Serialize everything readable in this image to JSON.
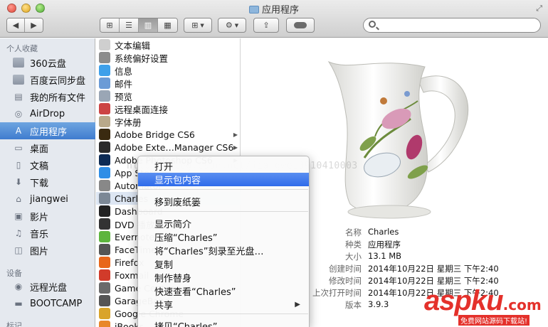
{
  "window": {
    "title": "应用程序"
  },
  "sidebar": {
    "favorites_header": "个人收藏",
    "devices_header": "设备",
    "tags_header": "标记",
    "favorites": [
      {
        "label": "360云盘",
        "icon": "folder-icon"
      },
      {
        "label": "百度云同步盘",
        "icon": "folder-icon"
      },
      {
        "label": "我的所有文件",
        "icon": "all-files-icon"
      },
      {
        "label": "AirDrop",
        "icon": "airdrop-icon"
      },
      {
        "label": "应用程序",
        "icon": "applications-icon",
        "selected": true
      },
      {
        "label": "桌面",
        "icon": "desktop-icon"
      },
      {
        "label": "文稿",
        "icon": "documents-icon"
      },
      {
        "label": "下载",
        "icon": "downloads-icon"
      },
      {
        "label": "jiangwei",
        "icon": "home-icon"
      },
      {
        "label": "影片",
        "icon": "movies-icon"
      },
      {
        "label": "音乐",
        "icon": "music-icon"
      },
      {
        "label": "图片",
        "icon": "pictures-icon"
      }
    ],
    "devices": [
      {
        "label": "远程光盘",
        "icon": "remote-disc-icon"
      },
      {
        "label": "BOOTCAMP",
        "icon": "drive-icon"
      }
    ]
  },
  "files": [
    {
      "label": "文本编辑",
      "color": "#cfcfcf",
      "arrow": false
    },
    {
      "label": "系统偏好设置",
      "color": "#8c8c8c",
      "arrow": false
    },
    {
      "label": "信息",
      "color": "#3ea0ea",
      "arrow": false
    },
    {
      "label": "邮件",
      "color": "#6b9bd6",
      "arrow": false
    },
    {
      "label": "预览",
      "color": "#9aa6b5",
      "arrow": false
    },
    {
      "label": "远程桌面连接",
      "color": "#c44",
      "arrow": false
    },
    {
      "label": "字体册",
      "color": "#b9a98a",
      "arrow": false
    },
    {
      "label": "Adobe Bridge CS6",
      "color": "#3a2a10",
      "arrow": true
    },
    {
      "label": "Adobe Exte…Manager CS6",
      "color": "#2b2b2b",
      "arrow": true
    },
    {
      "label": "Adobe Photoshop CS6",
      "color": "#0d2b55",
      "arrow": true
    },
    {
      "label": "App Store",
      "color": "#2f8ee6",
      "arrow": false
    },
    {
      "label": "Automator",
      "color": "#888",
      "arrow": false
    },
    {
      "label": "Charles",
      "color": "#7c8896",
      "arrow": false,
      "highlighted": true
    },
    {
      "label": "Dashboard",
      "color": "#222",
      "arrow": false
    },
    {
      "label": "DVD 播放程序",
      "color": "#333",
      "arrow": false
    },
    {
      "label": "Evernote",
      "color": "#5db53e",
      "arrow": false
    },
    {
      "label": "FaceTime",
      "color": "#555",
      "arrow": false
    },
    {
      "label": "Firefox",
      "color": "#e8661a",
      "arrow": false
    },
    {
      "label": "Foxmail",
      "color": "#d13b2a",
      "arrow": false
    },
    {
      "label": "Game Center",
      "color": "#6a6a6a",
      "arrow": false
    },
    {
      "label": "GarageBand",
      "color": "#555",
      "arrow": false
    },
    {
      "label": "Google Chrome",
      "color": "#d9a42a",
      "arrow": false
    },
    {
      "label": "iBooks",
      "color": "#e8872a",
      "arrow": false
    }
  ],
  "context_menu": {
    "items": [
      {
        "label": "打开"
      },
      {
        "label": "显示包内容",
        "active": true
      },
      {
        "label": "移到废纸篓"
      },
      {
        "label": "显示简介"
      },
      {
        "label": "压缩“Charles”"
      },
      {
        "label": "将“Charles”刻录至光盘…"
      },
      {
        "label": "复制"
      },
      {
        "label": "制作替身"
      },
      {
        "label": "快速查看“Charles”"
      },
      {
        "label": "共享",
        "submenu": true
      },
      {
        "label": "拷贝“Charles”"
      }
    ]
  },
  "preview": {
    "info": [
      {
        "key": "名称",
        "value": "Charles"
      },
      {
        "key": "种类",
        "value": "应用程序"
      },
      {
        "key": "大小",
        "value": "13.1 MB"
      },
      {
        "key": "创建时间",
        "value": "2014年10月22日 星期三 下午2:40"
      },
      {
        "key": "修改时间",
        "value": "2014年10月22日 星期三 下午2:40"
      },
      {
        "key": "上次打开时间",
        "value": "2014年10月22日 星期三 下午2:40"
      },
      {
        "key": "版本",
        "value": "3.9.3"
      }
    ]
  },
  "watermark": {
    "url": "http://blog.csdn.net/jiangwei0910410003",
    "logo_main": "asp",
    "logo_ku": "ku",
    "logo_com": ".com",
    "logo_sub": "免费网站源码下载站!"
  }
}
